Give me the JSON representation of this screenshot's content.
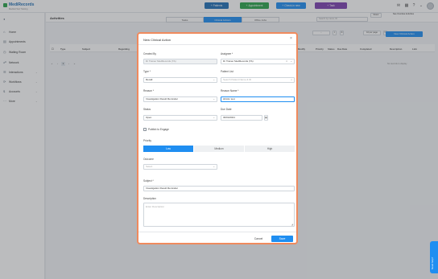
{
  "header": {
    "logo_text": "MediRecords",
    "logo_sub": "Medical Test Training",
    "buttons": [
      {
        "label": "Patients",
        "icon": "plus",
        "color": "#1f6fb5"
      },
      {
        "label": "Appointment",
        "icon": "plus",
        "color": "#2aa34a"
      },
      {
        "label": "Check-in new",
        "icon": "plus",
        "color": "#1f8ef1"
      },
      {
        "label": "Task",
        "icon": "plus",
        "color": "#7b3fb0"
      }
    ]
  },
  "sidebar": {
    "items": [
      {
        "label": "Home",
        "icon": "home-icon",
        "has_caret": false
      },
      {
        "label": "Appointments",
        "icon": "calendar-icon",
        "has_caret": false
      },
      {
        "label": "Waiting Room",
        "icon": "waiting-room-icon",
        "has_caret": false
      },
      {
        "label": "Network",
        "icon": "network-icon",
        "has_caret": false
      },
      {
        "label": "Interactions",
        "icon": "interactions-icon",
        "has_caret": true
      },
      {
        "label": "Workflows",
        "icon": "workflows-icon",
        "has_caret": true
      },
      {
        "label": "Accounts",
        "icon": "accounts-icon",
        "has_caret": true
      },
      {
        "label": "More",
        "icon": "more-icon",
        "has_caret": true
      }
    ]
  },
  "main": {
    "title": "Activities",
    "tabs": [
      "Tasks",
      "Clinical Actions",
      "Office Jobs"
    ],
    "active_tab": 1,
    "filter_placeholder": "Search by name, ID",
    "reset_label": "Reset",
    "see_overdue_label": "See Overdue Activities",
    "page_size": "10 per page",
    "new_button": "New Clinical Action",
    "columns": [
      "Type",
      "Subject",
      "Regarding",
      "Modify",
      "Priority",
      "Status",
      "Due Date",
      "Completed",
      "Description",
      "Link"
    ],
    "pager": [
      "«",
      "‹",
      "1",
      "›",
      "»"
    ],
    "no_data": "No records to display"
  },
  "modal": {
    "title": "New Clinical Action",
    "created_by_label": "Created By",
    "created_by_value": "Dr Trainer MedRecords (TA)",
    "assignee_label": "Assignee *",
    "assignee_value": "Dr Trainer MedRecords (TA)",
    "type_label": "Type *",
    "type_value": "Recall",
    "patient_label": "Patient List",
    "patient_placeholder": "Search Patient Name & ID",
    "reason_label": "Reason *",
    "reason_value": "Investigation Result Reminder",
    "reason_name_label": "Reason Name *",
    "reason_name_value": "HbA1c test",
    "status_label": "Status",
    "status_value": "Open",
    "due_date_label": "Due Date",
    "due_date_value": "30/04/2021",
    "publish_label": "Publish to Engage",
    "priority_label": "Priority",
    "priority_options": [
      "Low",
      "Medium",
      "High"
    ],
    "priority_selected": 0,
    "outcome_label": "Outcome",
    "outcome_placeholder": "Select",
    "subject_label": "Subject *",
    "subject_value": "Investigation Result Reminder",
    "description_label": "Description",
    "description_placeholder": "Enter Description",
    "cancel_label": "Cancel",
    "save_label": "Save"
  },
  "help_label": "Need help?"
}
